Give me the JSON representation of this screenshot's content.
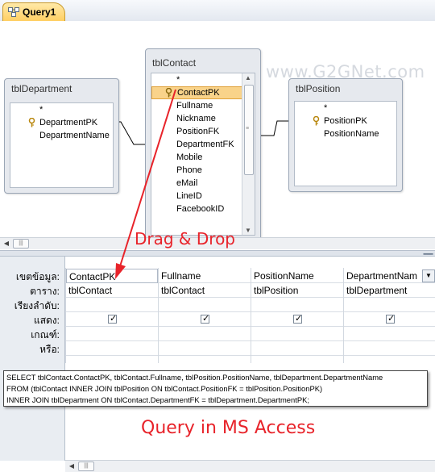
{
  "tab": {
    "label": "Query1"
  },
  "watermark": "www.G2GNet.com",
  "tables": {
    "department": {
      "title": "tblDepartment",
      "fields": [
        "*",
        "DepartmentPK",
        "DepartmentName"
      ]
    },
    "contact": {
      "title": "tblContact",
      "fields": [
        "*",
        "ContactPK",
        "Fullname",
        "Nickname",
        "PositionFK",
        "DepartmentFK",
        "Mobile",
        "Phone",
        "eMail",
        "LineID",
        "FacebookID"
      ]
    },
    "position": {
      "title": "tblPosition",
      "fields": [
        "*",
        "PositionPK",
        "PositionName"
      ]
    }
  },
  "grid": {
    "row_labels": [
      "เขตข้อมูล:",
      "ตาราง:",
      "เรียงลำดับ:",
      "แสดง:",
      "เกณฑ์:",
      "หรือ:"
    ],
    "columns": [
      {
        "field": "ContactPK",
        "table": "tblContact",
        "show": true
      },
      {
        "field": "Fullname",
        "table": "tblContact",
        "show": true
      },
      {
        "field": "PositionName",
        "table": "tblPosition",
        "show": true
      },
      {
        "field": "DepartmentNam",
        "table": "tblDepartment",
        "show": true
      }
    ]
  },
  "sql": [
    "SELECT tblContact.ContactPK, tblContact.Fullname, tblPosition.PositionName, tblDepartment.DepartmentName",
    "FROM (tblContact INNER JOIN tblPosition ON tblContact.PositionFK = tblPosition.PositionPK)",
    "INNER JOIN tblDepartment ON tblContact.DepartmentFK = tblDepartment.DepartmentPK;"
  ],
  "annotations": {
    "drag": "Drag & Drop",
    "query": "Query in MS Access"
  },
  "colors": {
    "annotation": "#e8232a",
    "selected_field": "#f9d38a"
  }
}
